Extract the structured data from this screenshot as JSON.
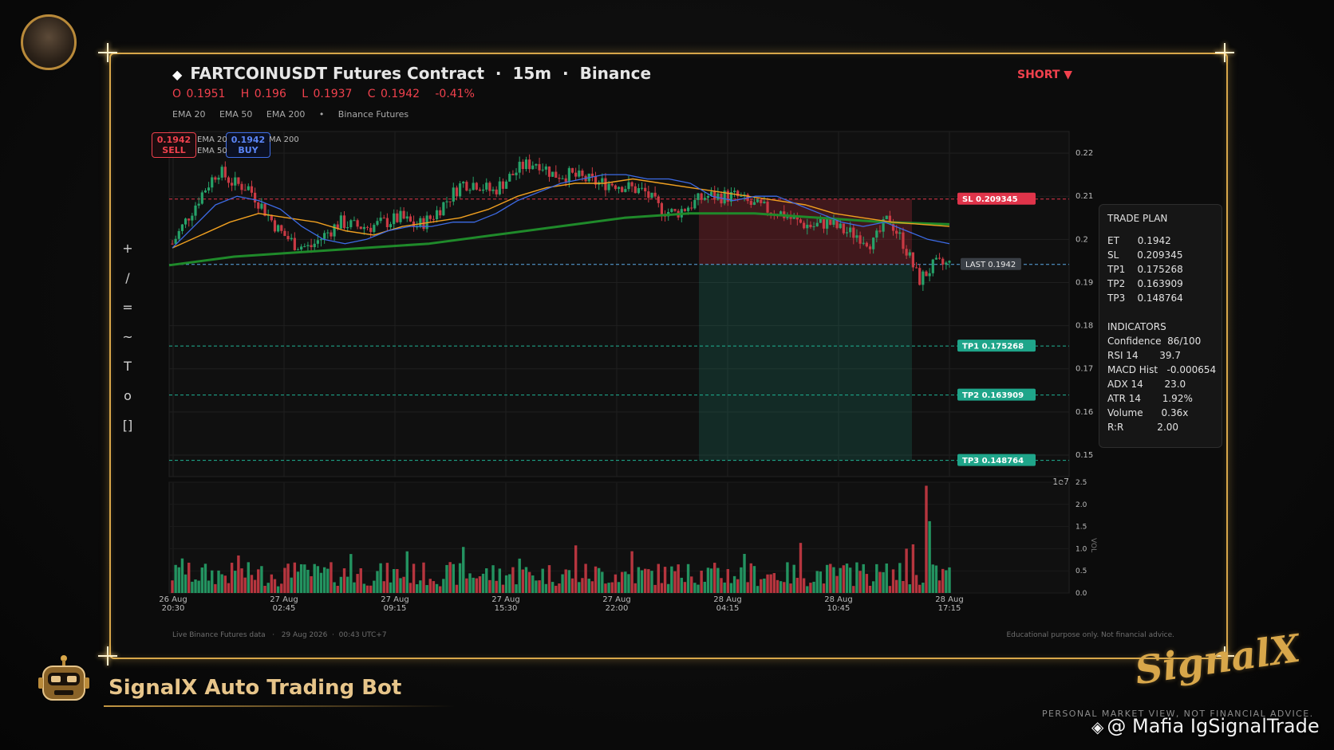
{
  "header": {
    "title": "FARTCOINUSDT Futures Contract  ·  15m  ·  Binance",
    "ohlc": "O 0.1951   H 0.196   L 0.1937   C 0.1942   -0.41%",
    "indicator_row": "EMA 20     EMA 50     EMA 200     •     Binance Futures",
    "direction": "SHORT ▼"
  },
  "badges": {
    "sell_price": "0.1942",
    "sell_label": "SELL",
    "buy_price": "0.1942",
    "buy_label": "BUY",
    "ema20": "EMA 20",
    "ema50": "EMA 50",
    "ema200": "MA 200"
  },
  "tools": [
    "+",
    "/",
    "=",
    "~",
    "T",
    "o",
    "[]"
  ],
  "levels": {
    "sl": "SL  0.209345",
    "last": "LAST  0.1942",
    "tp1": "TP1  0.175268",
    "tp2": "TP2  0.163909",
    "tp3": "TP3  0.148764"
  },
  "trade_plan": {
    "title": "TRADE PLAN",
    "rows": [
      "ET      0.1942",
      "SL      0.209345",
      "TP1    0.175268",
      "TP2    0.163909",
      "TP3    0.148764"
    ],
    "indicators_title": "INDICATORS",
    "indicators": [
      "Confidence  86/100",
      "RSI 14       39.7",
      "MACD Hist   -0.000654",
      "ADX 14       23.0",
      "ATR 14       1.92%",
      "Volume      0.36x",
      "R:R           2.00"
    ]
  },
  "colors": {
    "up": "#26a269",
    "down": "#c93a44",
    "ema20": "#3d6be6",
    "ema50": "#f0a020",
    "ema200": "#1f8a2a",
    "gold": "#d8a74a"
  },
  "chart_data": {
    "type": "candlestick",
    "price_ticks": [
      "0.22",
      "0.21",
      "0.2",
      "0.19",
      "0.18",
      "0.17",
      "0.16",
      "0.15"
    ],
    "price_range": [
      0.145,
      0.225
    ],
    "exponent_label": "1e7",
    "volume_ticks": [
      "2.5",
      "2.0",
      "1.5",
      "1.0",
      "0.5",
      "0.0"
    ],
    "volume_range": [
      0,
      2.5
    ],
    "volume_axis_label": "VOL",
    "x_ticks": [
      [
        "26 Aug",
        "20:30"
      ],
      [
        "27 Aug",
        "02:45"
      ],
      [
        "27 Aug",
        "09:15"
      ],
      [
        "27 Aug",
        "15:30"
      ],
      [
        "27 Aug",
        "22:00"
      ],
      [
        "28 Aug",
        "04:15"
      ],
      [
        "28 Aug",
        "10:45"
      ],
      [
        "28 Aug",
        "17:15"
      ]
    ],
    "close_path": [
      0.199,
      0.205,
      0.211,
      0.216,
      0.213,
      0.212,
      0.207,
      0.202,
      0.199,
      0.198,
      0.201,
      0.204,
      0.203,
      0.203,
      0.204,
      0.205,
      0.203,
      0.205,
      0.209,
      0.213,
      0.213,
      0.211,
      0.214,
      0.217,
      0.218,
      0.215,
      0.215,
      0.214,
      0.213,
      0.213,
      0.212,
      0.211,
      0.207,
      0.206,
      0.208,
      0.21,
      0.21,
      0.21,
      0.208,
      0.207,
      0.206,
      0.204,
      0.203,
      0.204,
      0.202,
      0.201,
      0.199,
      0.205,
      0.199,
      0.1905,
      0.194,
      0.1942
    ],
    "ema20": [
      0.198,
      0.203,
      0.208,
      0.21,
      0.209,
      0.207,
      0.203,
      0.2,
      0.199,
      0.2,
      0.202,
      0.203,
      0.203,
      0.204,
      0.204,
      0.206,
      0.209,
      0.211,
      0.213,
      0.214,
      0.215,
      0.215,
      0.214,
      0.214,
      0.213,
      0.21,
      0.209,
      0.21,
      0.21,
      0.208,
      0.206,
      0.204,
      0.203,
      0.204,
      0.202,
      0.2,
      0.199
    ],
    "ema50": [
      0.198,
      0.201,
      0.204,
      0.206,
      0.205,
      0.204,
      0.202,
      0.201,
      0.203,
      0.204,
      0.205,
      0.207,
      0.21,
      0.212,
      0.213,
      0.213,
      0.214,
      0.213,
      0.212,
      0.211,
      0.21,
      0.209,
      0.208,
      0.206,
      0.205,
      0.204,
      0.2035,
      0.203
    ],
    "ema200": [
      0.194,
      0.196,
      0.197,
      0.198,
      0.199,
      0.201,
      0.203,
      0.205,
      0.206,
      0.206,
      0.205,
      0.204,
      0.2035
    ],
    "volume_spikes": [
      {
        "x": "28 Aug 16:45",
        "vol": 2.42
      },
      {
        "x": "28 Aug 17:00",
        "vol": 1.62
      }
    ],
    "trade_zone": {
      "entry": 0.1942,
      "stop": 0.209345,
      "target": 0.148764
    }
  },
  "footer": {
    "left": "Live Binance Futures data   ·   29 Aug 2026  ·  00:43 UTC+7",
    "right": "Educational purpose only. Not financial advice."
  },
  "branding": {
    "bot_name": "SignalX Auto Trading Bot",
    "logo": "SignalX",
    "tagline": "PERSONAL MARKET VIEW, NOT FINANCIAL ADVICE.",
    "watermark": "@ Mafia IgSignalTrade"
  }
}
